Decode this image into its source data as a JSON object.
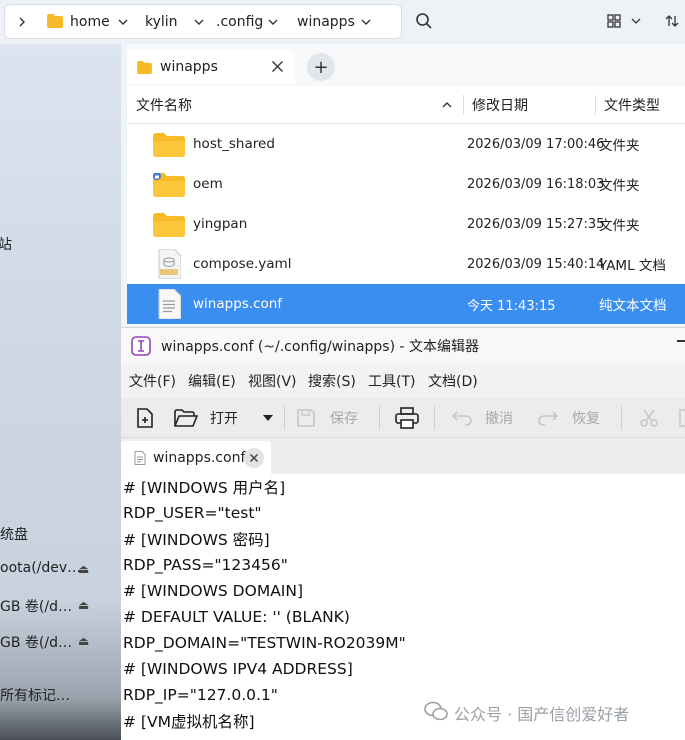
{
  "path_bar": {
    "crumbs": [
      "home",
      "kylin",
      ".config",
      "winapps"
    ]
  },
  "sidebar": {
    "items": [
      {
        "label": "站"
      },
      {
        "label": "统盘"
      },
      {
        "label": "oota(/dev…"
      },
      {
        "label": "GB 卷(/d…"
      },
      {
        "label": "GB 卷(/d…"
      },
      {
        "label": "所有标记…"
      }
    ]
  },
  "file_manager": {
    "tab_label": "winapps",
    "columns": {
      "name": "文件名称",
      "date": "修改日期",
      "type": "文件类型"
    },
    "rows": [
      {
        "name": "host_shared",
        "date": "2026/03/09 17:00:46",
        "type": "文件夹",
        "icon": "folder-icon"
      },
      {
        "name": "oem",
        "date": "2026/03/09 16:18:03",
        "type": "文件夹",
        "icon": "folder-locked-icon"
      },
      {
        "name": "yingpan",
        "date": "2026/03/09 15:27:35",
        "type": "文件夹",
        "icon": "folder-icon"
      },
      {
        "name": "compose.yaml",
        "date": "2026/03/09 15:40:14",
        "type": "YAML 文档",
        "icon": "yaml-file-icon"
      },
      {
        "name": "winapps.conf",
        "date": "今天 11:43:15",
        "type": "纯文本文档",
        "icon": "text-file-icon"
      }
    ]
  },
  "editor": {
    "title": "winapps.conf (~/.config/winapps) - 文本编辑器",
    "menu": [
      "文件(F)",
      "编辑(E)",
      "视图(V)",
      "搜索(S)",
      "工具(T)",
      "文档(D)"
    ],
    "toolbar": {
      "open": "打开",
      "save": "保存",
      "undo": "撤消",
      "redo": "恢复"
    },
    "tab_label": "winapps.conf",
    "lines": [
      "# [WINDOWS 用户名]",
      "RDP_USER=\"test\"",
      "# [WINDOWS 密码]",
      "RDP_PASS=\"123456\"",
      "# [WINDOWS DOMAIN]",
      "# DEFAULT VALUE: '' (BLANK)",
      "RDP_DOMAIN=\"TESTWIN-RO2039M\"",
      "# [WINDOWS IPV4 ADDRESS]",
      "RDP_IP=\"127.0.0.1\"",
      "# [VM虚拟机名称]"
    ]
  },
  "watermark": "公众号 · 国产信创爱好者",
  "colors": {
    "selection": "#3a8ef0",
    "folder": "#f7b928",
    "accent_icon": "#9b3fb5"
  }
}
